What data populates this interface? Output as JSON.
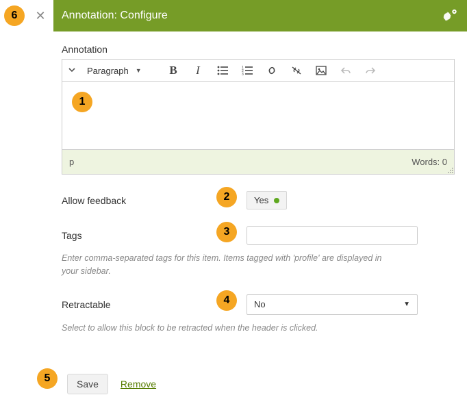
{
  "markers": {
    "1": "1",
    "2": "2",
    "3": "3",
    "4": "4",
    "5": "5",
    "6": "6"
  },
  "header": {
    "title": "Annotation: Configure"
  },
  "editor": {
    "label": "Annotation",
    "format_current": "Paragraph",
    "path_display": "p",
    "word_count_label": "Words: 0"
  },
  "allow_feedback": {
    "label": "Allow feedback",
    "value": "Yes"
  },
  "tags": {
    "label": "Tags",
    "value": "",
    "help": "Enter comma-separated tags for this item. Items tagged with 'profile' are displayed in your sidebar."
  },
  "retractable": {
    "label": "Retractable",
    "value": "No",
    "help": "Select to allow this block to be retracted when the header is clicked."
  },
  "actions": {
    "save": "Save",
    "remove": "Remove"
  }
}
